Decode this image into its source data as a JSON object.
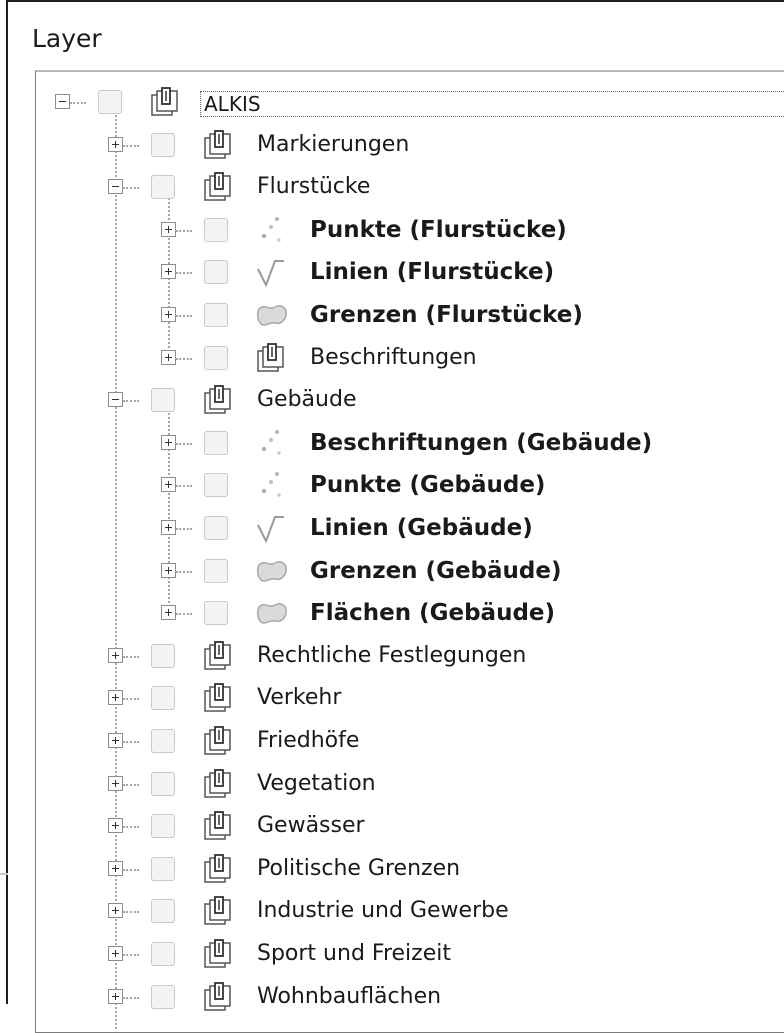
{
  "panel": {
    "title": "Layer"
  },
  "tree": {
    "items": [
      {
        "label": "ALKIS",
        "level": 0,
        "expander": "minus",
        "icon": "group-layer-icon",
        "bold": false
      },
      {
        "label": "Markierungen",
        "level": 1,
        "expander": "plus",
        "icon": "group-layer-icon",
        "bold": false
      },
      {
        "label": "Flurstücke",
        "level": 1,
        "expander": "minus",
        "icon": "group-layer-icon",
        "bold": false
      },
      {
        "label": "Punkte (Flurstücke)",
        "level": 2,
        "expander": "plus",
        "icon": "point-layer-icon",
        "bold": true
      },
      {
        "label": "Linien (Flurstücke)",
        "level": 2,
        "expander": "plus",
        "icon": "line-layer-icon",
        "bold": true
      },
      {
        "label": "Grenzen (Flurstücke)",
        "level": 2,
        "expander": "plus",
        "icon": "polygon-layer-icon",
        "bold": true
      },
      {
        "label": "Beschriftungen",
        "level": 2,
        "expander": "plus",
        "icon": "group-layer-icon",
        "bold": false
      },
      {
        "label": "Gebäude",
        "level": 1,
        "expander": "minus",
        "icon": "group-layer-icon",
        "bold": false
      },
      {
        "label": "Beschriftungen (Gebäude)",
        "level": 2,
        "expander": "plus",
        "icon": "point-layer-icon",
        "bold": true
      },
      {
        "label": "Punkte (Gebäude)",
        "level": 2,
        "expander": "plus",
        "icon": "point-layer-icon",
        "bold": true
      },
      {
        "label": "Linien (Gebäude)",
        "level": 2,
        "expander": "plus",
        "icon": "line-layer-icon",
        "bold": true
      },
      {
        "label": "Grenzen (Gebäude)",
        "level": 2,
        "expander": "plus",
        "icon": "polygon-layer-icon",
        "bold": true
      },
      {
        "label": "Flächen (Gebäude)",
        "level": 2,
        "expander": "plus",
        "icon": "polygon-layer-icon",
        "bold": true
      },
      {
        "label": "Rechtliche Festlegungen",
        "level": 1,
        "expander": "plus",
        "icon": "group-layer-icon",
        "bold": false
      },
      {
        "label": "Verkehr",
        "level": 1,
        "expander": "plus",
        "icon": "group-layer-icon",
        "bold": false
      },
      {
        "label": "Friedhöfe",
        "level": 1,
        "expander": "plus",
        "icon": "group-layer-icon",
        "bold": false
      },
      {
        "label": "Vegetation",
        "level": 1,
        "expander": "plus",
        "icon": "group-layer-icon",
        "bold": false
      },
      {
        "label": "Gewässer",
        "level": 1,
        "expander": "plus",
        "icon": "group-layer-icon",
        "bold": false
      },
      {
        "label": "Politische Grenzen",
        "level": 1,
        "expander": "plus",
        "icon": "group-layer-icon",
        "bold": false
      },
      {
        "label": "Industrie und Gewerbe",
        "level": 1,
        "expander": "plus",
        "icon": "group-layer-icon",
        "bold": false
      },
      {
        "label": "Sport und Freizeit",
        "level": 1,
        "expander": "plus",
        "icon": "group-layer-icon",
        "bold": false
      },
      {
        "label": "Wohnbauflächen",
        "level": 1,
        "expander": "plus",
        "icon": "group-layer-icon",
        "bold": false
      }
    ]
  }
}
